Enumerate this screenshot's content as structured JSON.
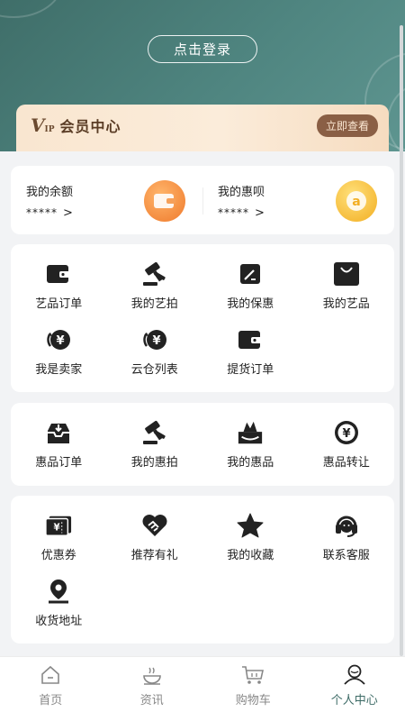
{
  "header": {
    "login_label": "点击登录",
    "vip_logo": "V",
    "vip_logo_sub": "IP",
    "vip_title": "会员中心",
    "vip_button": "立即查看"
  },
  "balance": [
    {
      "label": "我的余额",
      "value": "*****",
      "icon": "wallet-coin-icon",
      "color": "#f08a3c"
    },
    {
      "label": "我的惠呗",
      "value": "*****",
      "icon": "gold-coin-icon",
      "color": "#f5b72e"
    }
  ],
  "section_art": [
    {
      "label": "艺品订单",
      "icon": "wallet-icon"
    },
    {
      "label": "我的艺拍",
      "icon": "auction-hammer-icon"
    },
    {
      "label": "我的保惠",
      "icon": "edit-note-icon"
    },
    {
      "label": "我的艺品",
      "icon": "shopping-bag-icon"
    },
    {
      "label": "我是卖家",
      "icon": "yuan-exchange-icon"
    },
    {
      "label": "云仓列表",
      "icon": "yuan-exchange-icon"
    },
    {
      "label": "提货订单",
      "icon": "wallet-icon"
    }
  ],
  "section_hui": [
    {
      "label": "惠品订单",
      "icon": "inbox-icon"
    },
    {
      "label": "我的惠拍",
      "icon": "auction-hammer-icon"
    },
    {
      "label": "我的惠品",
      "icon": "gift-box-icon"
    },
    {
      "label": "惠品转让",
      "icon": "yuan-circle-icon"
    }
  ],
  "section_other": [
    {
      "label": "优惠券",
      "icon": "coupon-icon"
    },
    {
      "label": "推荐有礼",
      "icon": "handshake-heart-icon"
    },
    {
      "label": "我的收藏",
      "icon": "star-icon"
    },
    {
      "label": "联系客服",
      "icon": "headset-icon"
    },
    {
      "label": "收货地址",
      "icon": "location-pin-icon"
    }
  ],
  "tabbar": [
    {
      "label": "首页",
      "icon": "home-icon",
      "active": false
    },
    {
      "label": "资讯",
      "icon": "news-bowl-icon",
      "active": false
    },
    {
      "label": "购物车",
      "icon": "cart-icon",
      "active": false
    },
    {
      "label": "个人中心",
      "icon": "user-icon",
      "active": true
    }
  ],
  "colors": {
    "header": "#4a7d78",
    "accent": "#3d6b66",
    "icon": "#222222"
  }
}
